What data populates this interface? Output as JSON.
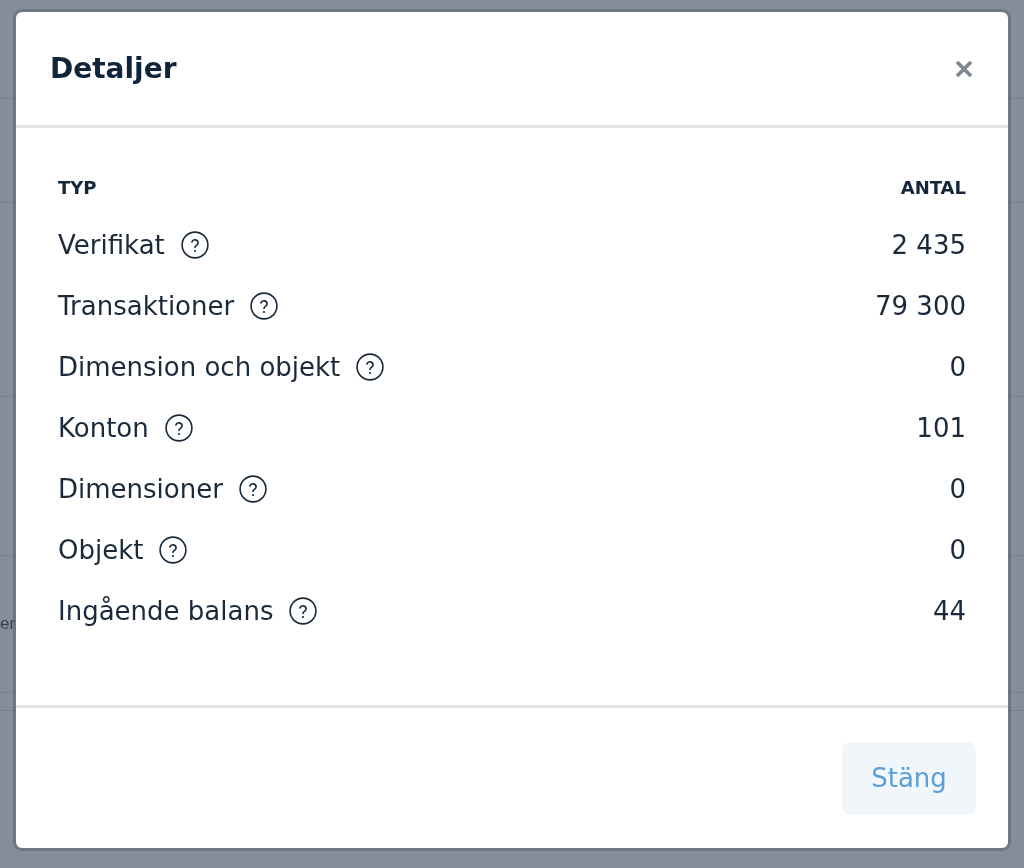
{
  "background_page": {
    "text_fragment": "er"
  },
  "dialog": {
    "title": "Detaljer",
    "table": {
      "columns": [
        "TYP",
        "ANTAL"
      ],
      "rows": [
        {
          "type": "Verifikat",
          "count": "2 435"
        },
        {
          "type": "Transaktioner",
          "count": "79 300"
        },
        {
          "type": "Dimension och objekt",
          "count": "0"
        },
        {
          "type": "Konton",
          "count": "101"
        },
        {
          "type": "Dimensioner",
          "count": "0"
        },
        {
          "type": "Objekt",
          "count": "0"
        },
        {
          "type": "Ingående balans",
          "count": "44"
        }
      ]
    },
    "buttons": [
      "Stäng"
    ]
  }
}
